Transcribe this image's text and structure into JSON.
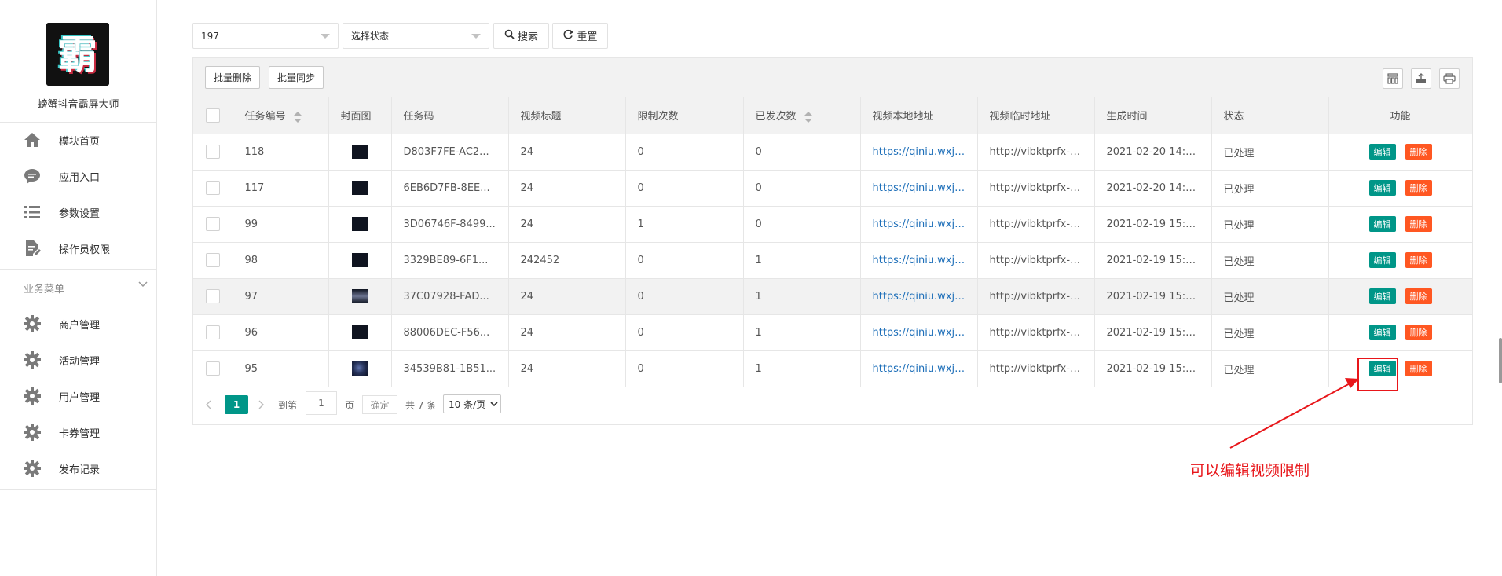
{
  "sidebar": {
    "logo_glyph": "霸",
    "app_name": "螃蟹抖音霸屏大师",
    "top_items": [
      {
        "label": "模块首页",
        "icon": "home-icon"
      },
      {
        "label": "应用入口",
        "icon": "chat-icon"
      },
      {
        "label": "参数设置",
        "icon": "list-icon"
      },
      {
        "label": "操作员权限",
        "icon": "edit-doc-icon"
      }
    ],
    "group_title": "业务菜单",
    "group_items": [
      {
        "label": "商户管理",
        "icon": "gear-icon"
      },
      {
        "label": "活动管理",
        "icon": "gear-icon"
      },
      {
        "label": "用户管理",
        "icon": "gear-icon"
      },
      {
        "label": "卡券管理",
        "icon": "gear-icon"
      },
      {
        "label": "发布记录",
        "icon": "gear-icon"
      }
    ]
  },
  "filters": {
    "id_value": "197",
    "status_placeholder": "选择状态",
    "search_label": "搜索",
    "reset_label": "重置"
  },
  "table_toolbar": {
    "batch_delete": "批量删除",
    "batch_sync": "批量同步",
    "icons": [
      "columns-icon",
      "export-icon",
      "print-icon"
    ]
  },
  "table": {
    "columns": [
      "任务编号",
      "封面图",
      "任务码",
      "视频标题",
      "限制次数",
      "已发次数",
      "视频本地地址",
      "视频临时地址",
      "生成时间",
      "状态",
      "功能"
    ],
    "rows": [
      {
        "id": "118",
        "code": "D803F7FE-AC2...",
        "title": "24",
        "limit": "0",
        "sent": "0",
        "local": "https://qiniu.wxj3...",
        "temp": "http://vibktprfx-p...",
        "time": "2021-02-20 14:3...",
        "status": "已处理"
      },
      {
        "id": "117",
        "code": "6EB6D7FB-8EE...",
        "title": "24",
        "limit": "0",
        "sent": "0",
        "local": "https://qiniu.wxj3...",
        "temp": "http://vibktprfx-p...",
        "time": "2021-02-20 14:3...",
        "status": "已处理"
      },
      {
        "id": "99",
        "code": "3D06746F-8499...",
        "title": "24",
        "limit": "1",
        "sent": "0",
        "local": "https://qiniu.wxj3...",
        "temp": "http://vibktprfx-p...",
        "time": "2021-02-19 15:3...",
        "status": "已处理"
      },
      {
        "id": "98",
        "code": "3329BE89-6F1...",
        "title": "242452",
        "limit": "0",
        "sent": "1",
        "local": "https://qiniu.wxj3...",
        "temp": "http://vibktprfx-p...",
        "time": "2021-02-19 15:3...",
        "status": "已处理"
      },
      {
        "id": "97",
        "code": "37C07928-FAD...",
        "title": "24",
        "limit": "0",
        "sent": "1",
        "local": "https://qiniu.wxj3...",
        "temp": "http://vibktprfx-p...",
        "time": "2021-02-19 15:3...",
        "status": "已处理"
      },
      {
        "id": "96",
        "code": "88006DEC-F56...",
        "title": "24",
        "limit": "0",
        "sent": "1",
        "local": "https://qiniu.wxj3...",
        "temp": "http://vibktprfx-p...",
        "time": "2021-02-19 15:3...",
        "status": "已处理"
      },
      {
        "id": "95",
        "code": "34539B81-1B51...",
        "title": "24",
        "limit": "0",
        "sent": "1",
        "local": "https://qiniu.wxj3...",
        "temp": "http://vibktprfx-p...",
        "time": "2021-02-19 15:3...",
        "status": "已处理"
      }
    ],
    "edit_label": "编辑",
    "delete_label": "删除"
  },
  "pagination": {
    "current_page": "1",
    "goto_label": "到第",
    "goto_value": "1",
    "page_label": "页",
    "confirm_label": "确定",
    "total_label": "共 7 条",
    "page_size": "10 条/页"
  },
  "annotation": {
    "text": "可以编辑视频限制",
    "color": "#e8161a"
  },
  "colors": {
    "primary": "#009688",
    "danger": "#ff5722",
    "link": "#1e6fb9"
  }
}
